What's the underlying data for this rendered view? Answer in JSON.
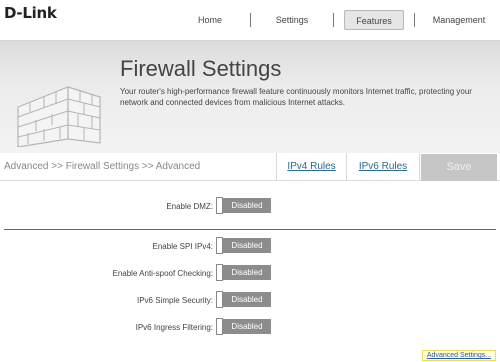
{
  "brand": {
    "logo_text": "D-Link"
  },
  "nav": {
    "home": "Home",
    "settings": "Settings",
    "features": "Features",
    "management": "Management"
  },
  "banner": {
    "title": "Firewall Settings",
    "description": "Your router's high-performance firewall feature continuously monitors Internet traffic, protecting your network and connected devices from malicious Internet attacks.",
    "image_icon": "brick-wall-icon"
  },
  "breadcrumb": "Advanced >> Firewall Settings >> Advanced",
  "tabs": {
    "ipv4": "IPv4 Rules",
    "ipv6": "IPv6 Rules"
  },
  "save_label": "Save",
  "rows": [
    {
      "label": "Enable DMZ:",
      "value": "Disabled"
    },
    {
      "label": "Enable SPI IPv4:",
      "value": "Disabled"
    },
    {
      "label": "Enable Anti-spoof Checking:",
      "value": "Disabled"
    },
    {
      "label": "IPv6 Simple Security:",
      "value": "Disabled"
    },
    {
      "label": "IPv6 Ingress Filtering:",
      "value": "Disabled"
    }
  ],
  "advanced_link": "Advanced Settings...",
  "colors": {
    "toggle_disabled": "#8c8c8c",
    "save_disabled": "#c6c6c6",
    "link": "#2a6a8a"
  }
}
